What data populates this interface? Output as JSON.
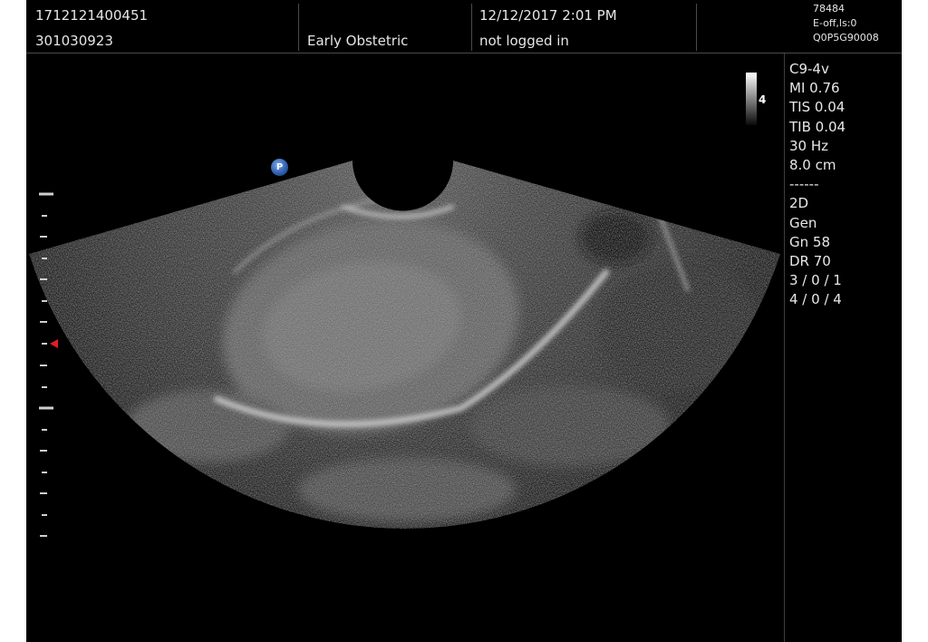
{
  "header": {
    "patient_id": "1712121400451",
    "patient_number": "301030923",
    "exam_type": "Early Obstetric",
    "datetime": "12/12/2017  2:01 PM",
    "login_status": "not logged in",
    "device": {
      "line1": "78484",
      "line2": "E-off,ls:0",
      "line3": "Q0P5G90008"
    }
  },
  "image": {
    "grayscale_value": "4",
    "probe_marker_label": "P"
  },
  "params": [
    "C9-4v",
    "MI 0.76",
    "TIS 0.04",
    "TIB 0.04",
    "30 Hz",
    "8.0 cm",
    "------",
    "2D",
    "Gen",
    "Gn 58",
    "DR 70",
    "3 / 0 / 1",
    "4 / 0 / 4"
  ],
  "colors": {
    "background": "#000000",
    "text": "#e6e6e6",
    "focus_marker": "#e02020",
    "probe_marker": "#2b5cab"
  }
}
